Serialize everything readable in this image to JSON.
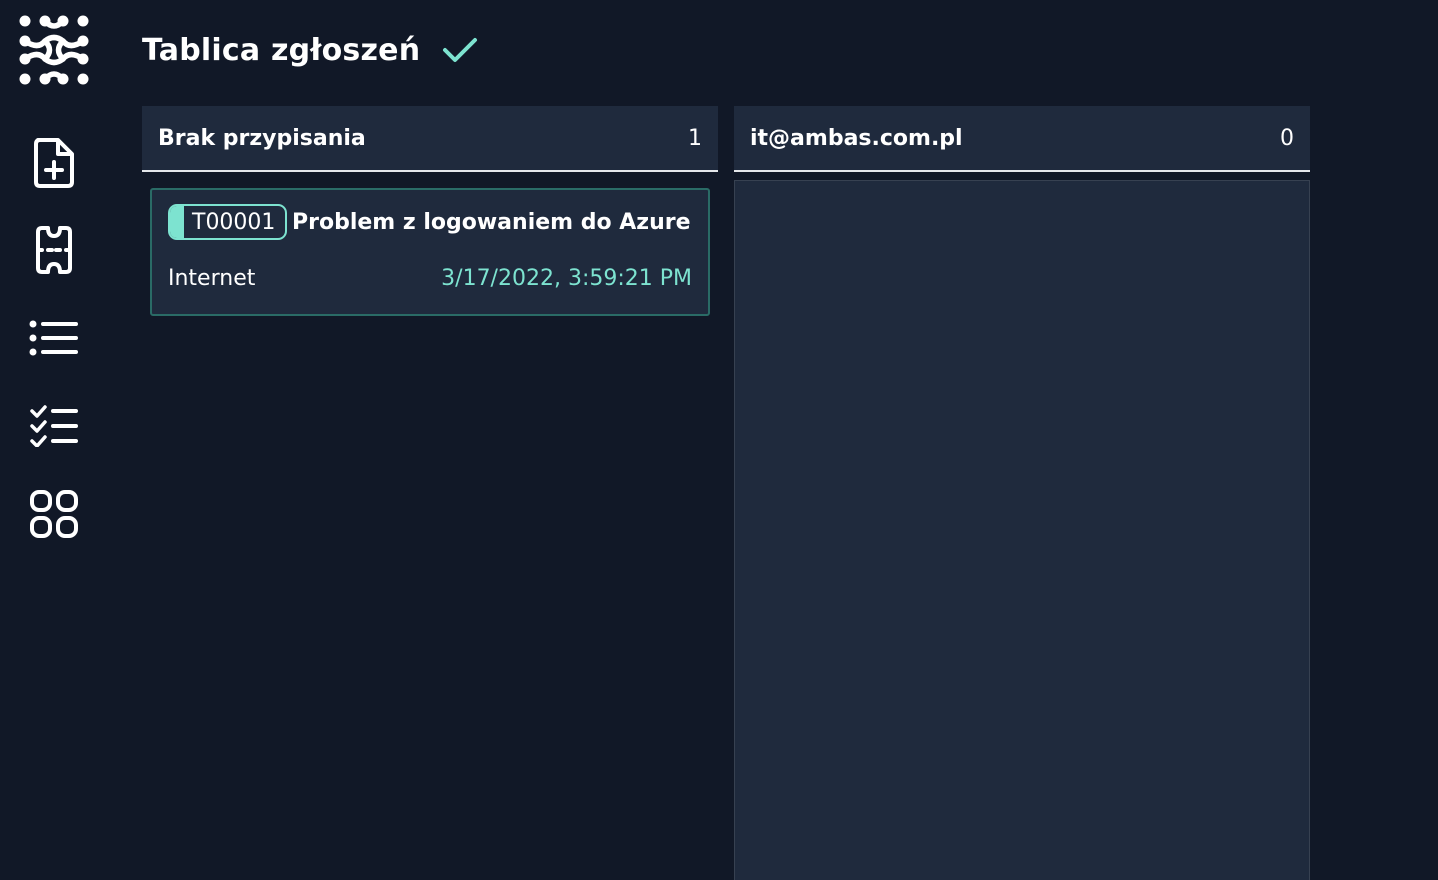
{
  "app": {
    "logo_icon": "molecule-logo-icon",
    "accent_color": "#7de3d0",
    "background_color": "#111827",
    "panel_color": "#1f2a3d"
  },
  "sidebar": {
    "items": [
      {
        "icon": "new-document-icon"
      },
      {
        "icon": "ticket-icon"
      },
      {
        "icon": "list-icon"
      },
      {
        "icon": "checklist-icon"
      },
      {
        "icon": "grid-icon"
      }
    ]
  },
  "header": {
    "title": "Tablica zgłoszeń",
    "status_icon": "check-icon"
  },
  "columns": [
    {
      "title": "Brak przypisania",
      "count": "1",
      "tickets": [
        {
          "id": "T00001",
          "title": "Problem z logowaniem do Azure",
          "category": "Internet",
          "date": "3/17/2022, 3:59:21 PM"
        }
      ]
    },
    {
      "title": "it@ambas.com.pl",
      "count": "0",
      "tickets": []
    }
  ]
}
